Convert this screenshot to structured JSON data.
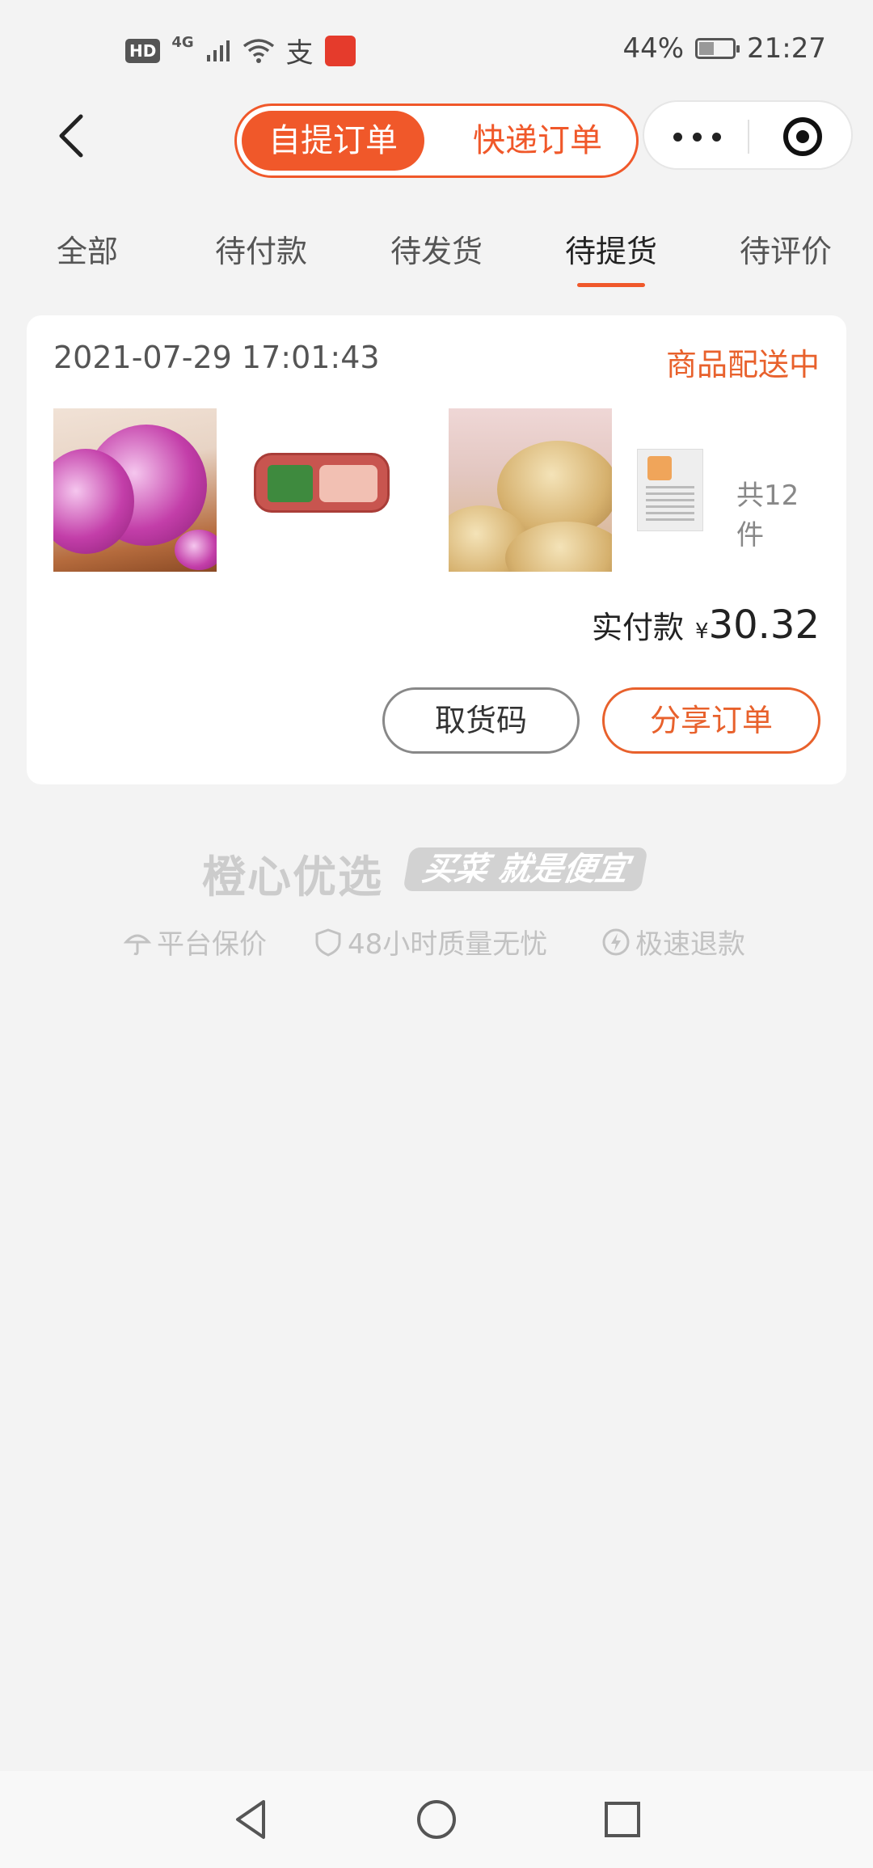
{
  "status_bar": {
    "hd": "HD",
    "network": "4G",
    "battery": "44%",
    "battery_level": 0.44,
    "time": "21:27",
    "icons": [
      "hd-icon",
      "signal-icon",
      "wifi-icon",
      "alipay-icon",
      "app-notification-icon",
      "battery-icon"
    ]
  },
  "header": {
    "segments": [
      "自提订单",
      "快递订单"
    ],
    "active_segment": 0
  },
  "tabs": [
    "全部",
    "待付款",
    "待发货",
    "待提货",
    "待评价"
  ],
  "active_tab": 3,
  "order": {
    "time": "2021-07-29 17:01:43",
    "status": "商品配送中",
    "products": [
      "onion",
      "ham-sausage-pack",
      "potato",
      "snack-bag"
    ],
    "count_text": "共12件",
    "paid_label": "实付款",
    "currency": "¥",
    "amount": "30.32",
    "btn_pickup_code": "取货码",
    "btn_share": "分享订单"
  },
  "brand": {
    "name": "橙心优选",
    "slogan": "买菜 就是便宜",
    "guarantees": [
      "平台保价",
      "48小时质量无忧",
      "极速退款"
    ]
  },
  "colors": {
    "accent": "#f0582a",
    "status": "#e8612c",
    "background": "#f3f3f3"
  }
}
